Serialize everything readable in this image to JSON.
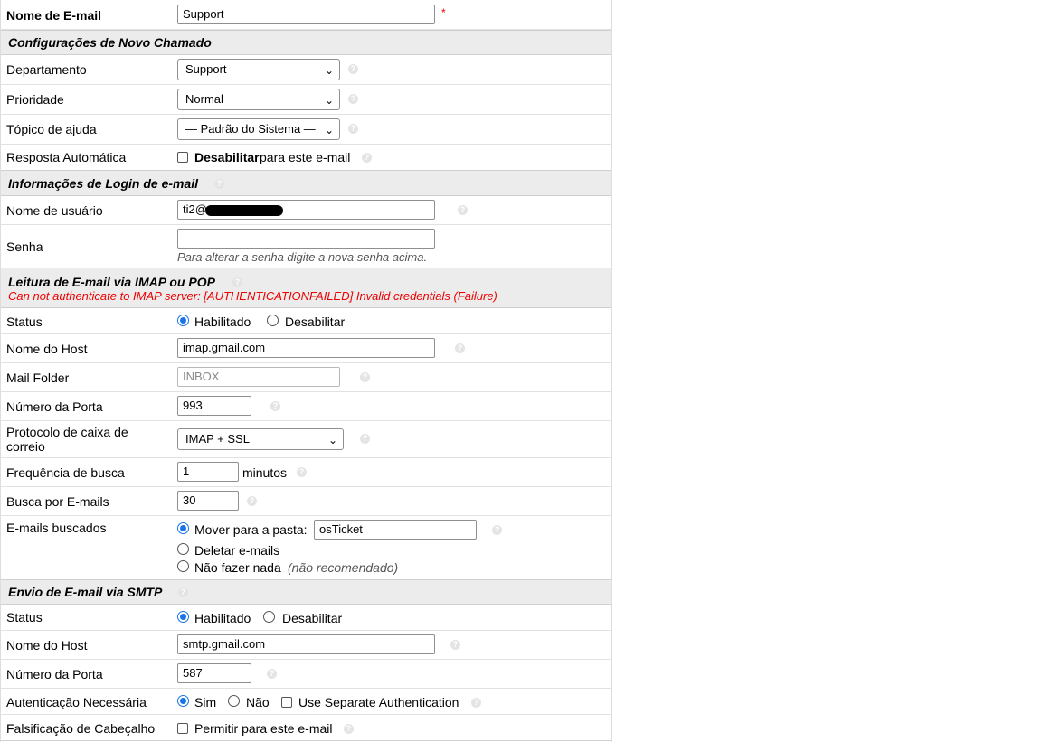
{
  "email_name": {
    "label": "Nome de E-mail",
    "value": "Support",
    "required_mark": "*"
  },
  "new_ticket_settings": {
    "title": "Configurações de Novo Chamado",
    "department": {
      "label": "Departamento",
      "value": "Support"
    },
    "priority": {
      "label": "Prioridade",
      "value": "Normal"
    },
    "help_topic": {
      "label": "Tópico de ajuda",
      "value": "— Padrão do Sistema —"
    },
    "auto_response": {
      "label": "Resposta Automática",
      "bold": "Desabilitar",
      "rest": "para este e-mail",
      "checked": false
    }
  },
  "login_info": {
    "title": "Informações de Login de e-mail",
    "username": {
      "label": "Nome de usuário",
      "value": "ti2@"
    },
    "password": {
      "label": "Senha",
      "value": "",
      "hint": "Para alterar a senha digite a nova senha acima."
    }
  },
  "imap": {
    "title": "Leitura de E-mail via IMAP ou POP",
    "error": "Can not authenticate to IMAP server: [AUTHENTICATIONFAILED] Invalid credentials (Failure)",
    "status": {
      "label": "Status",
      "enabled": "Habilitado",
      "disabled": "Desabilitar",
      "selected": "enabled"
    },
    "host": {
      "label": "Nome do Host",
      "value": "imap.gmail.com"
    },
    "folder": {
      "label": "Mail Folder",
      "placeholder": "INBOX"
    },
    "port": {
      "label": "Número da Porta",
      "value": "993"
    },
    "protocol": {
      "label": "Protocolo de caixa de correio",
      "value": "IMAP + SSL"
    },
    "frequency": {
      "label": "Frequência de busca",
      "value": "1",
      "unit": "minutos"
    },
    "fetch": {
      "label": "Busca por E-mails",
      "value": "30"
    },
    "fetched": {
      "label": "E-mails buscados",
      "move": "Mover para a pasta:",
      "folder": "osTicket",
      "delete": "Deletar e-mails",
      "nothing": "Não fazer nada",
      "nothing_note": "(não recomendado)",
      "selected": "move"
    }
  },
  "smtp": {
    "title": "Envio de E-mail via SMTP",
    "status": {
      "label": "Status",
      "enabled": "Habilitado",
      "disabled": "Desabilitar",
      "selected": "enabled"
    },
    "host": {
      "label": "Nome do Host",
      "value": "smtp.gmail.com"
    },
    "port": {
      "label": "Número da Porta",
      "value": "587"
    },
    "auth": {
      "label": "Autenticação Necessária",
      "yes": "Sim",
      "no": "Não",
      "separate": "Use Separate Authentication",
      "selected": "yes",
      "separate_checked": false
    },
    "spoof": {
      "label": "Falsificação de Cabeçalho",
      "text": "Permitir para este e-mail",
      "checked": false
    }
  },
  "help_glyph": "?",
  "chevron_glyph": "⌄"
}
